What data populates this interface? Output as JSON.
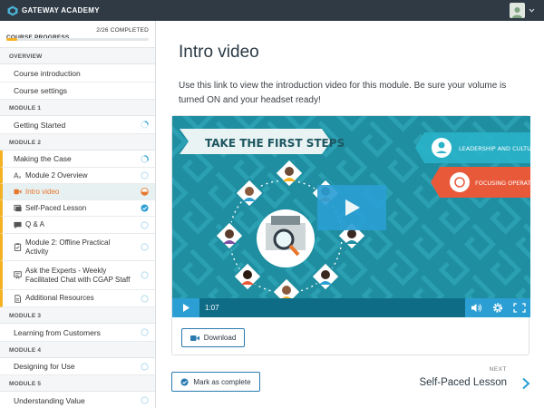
{
  "brand": {
    "name": "GATEWAY ACADEMY"
  },
  "progress": {
    "label": "COURSE PROGRESS",
    "count": "2/26 COMPLETED",
    "fraction": 0.077
  },
  "sidebar": {
    "overview_head": "OVERVIEW",
    "course_intro": "Course introduction",
    "course_settings": "Course settings",
    "module1_head": "MODULE 1",
    "getting_started": "Getting Started",
    "module2_head": "MODULE 2",
    "making_the_case": "Making the Case",
    "items": [
      {
        "label": "Module 2 Overview",
        "icon": "text-icon"
      },
      {
        "label": "Intro video",
        "icon": "video-icon"
      },
      {
        "label": "Self-Paced Lesson",
        "icon": "lesson-icon"
      },
      {
        "label": "Q & A",
        "icon": "chat-icon"
      },
      {
        "label": "Module 2: Offline Practical Activity",
        "icon": "clipboard-icon"
      },
      {
        "label": "Ask the Experts - Weekly Facilitated Chat with CGAP Staff",
        "icon": "presentation-icon"
      },
      {
        "label": "Additional Resources",
        "icon": "document-icon"
      }
    ],
    "module3_head": "MODULE 3",
    "learning_from_customers": "Learning from Customers",
    "module4_head": "MODULE 4",
    "designing_for_use": "Designing for Use",
    "module5_head": "MODULE 5",
    "understanding_value": "Understanding Value"
  },
  "main": {
    "title": "Intro video",
    "description": "Use this link to view the introduction video for this module. Be sure your volume is turned ON and your headset ready!",
    "video": {
      "banner": "TAKE THE FIRST STEPS",
      "tag1": "LEADERSHIP AND CULTURE",
      "tag2": "FOCUSING OPERATIO",
      "time": "1:07"
    },
    "download_label": "Download",
    "mark_complete_label": "Mark as complete",
    "next_label": "NEXT",
    "next_title": "Self-Paced Lesson"
  },
  "colors": {
    "accent": "#f4b223",
    "topbar": "#2f3a45",
    "video_bg": "#1f8ea0",
    "control_blue": "#2b9fd4",
    "orange": "#e8772e"
  }
}
